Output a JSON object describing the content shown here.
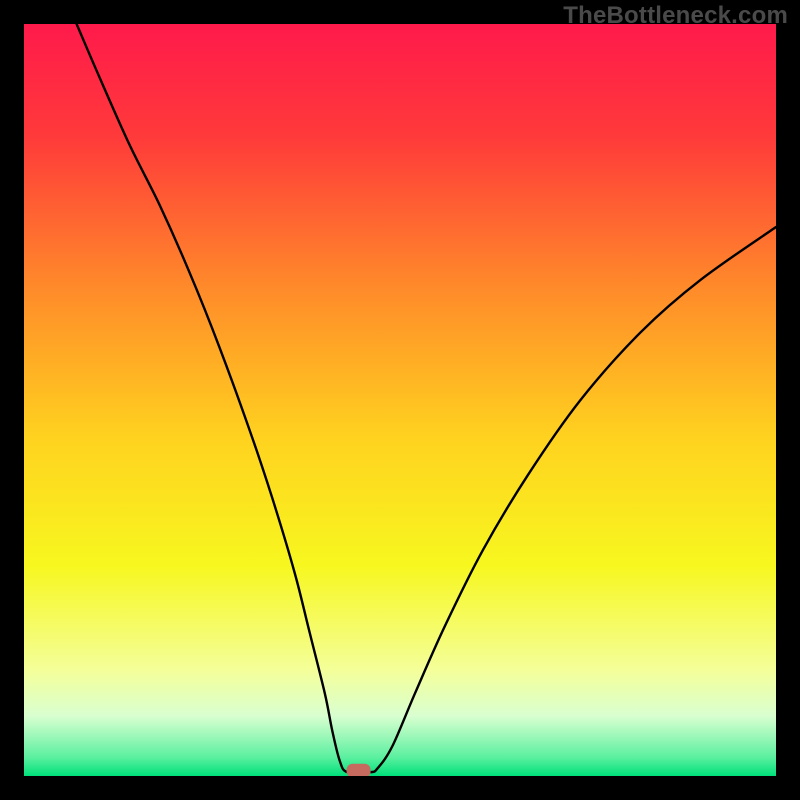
{
  "watermark": "TheBottleneck.com",
  "chart_data": {
    "type": "line",
    "title": "",
    "xlabel": "",
    "ylabel": "",
    "xlim": [
      0,
      100
    ],
    "ylim": [
      0,
      100
    ],
    "grid": false,
    "legend": false,
    "background_gradient": {
      "stops": [
        {
          "offset": 0.0,
          "color": "#ff1a4b"
        },
        {
          "offset": 0.15,
          "color": "#ff3a3a"
        },
        {
          "offset": 0.35,
          "color": "#ff8a2a"
        },
        {
          "offset": 0.55,
          "color": "#ffd21f"
        },
        {
          "offset": 0.72,
          "color": "#f7f71f"
        },
        {
          "offset": 0.86,
          "color": "#f4ff9a"
        },
        {
          "offset": 0.92,
          "color": "#d9ffd0"
        },
        {
          "offset": 0.975,
          "color": "#5cf0a0"
        },
        {
          "offset": 1.0,
          "color": "#00e07a"
        }
      ]
    },
    "series": [
      {
        "name": "bottleneck-curve",
        "color": "#000000",
        "points": [
          {
            "x": 7,
            "y": 100
          },
          {
            "x": 10,
            "y": 93
          },
          {
            "x": 14,
            "y": 84
          },
          {
            "x": 18,
            "y": 76
          },
          {
            "x": 22,
            "y": 67
          },
          {
            "x": 26,
            "y": 57
          },
          {
            "x": 30,
            "y": 46
          },
          {
            "x": 33,
            "y": 37
          },
          {
            "x": 36,
            "y": 27
          },
          {
            "x": 38,
            "y": 19
          },
          {
            "x": 40,
            "y": 11
          },
          {
            "x": 41,
            "y": 6
          },
          {
            "x": 42,
            "y": 2
          },
          {
            "x": 43,
            "y": 0.5
          },
          {
            "x": 46,
            "y": 0.5
          },
          {
            "x": 47,
            "y": 1
          },
          {
            "x": 49,
            "y": 4
          },
          {
            "x": 52,
            "y": 11
          },
          {
            "x": 56,
            "y": 20
          },
          {
            "x": 61,
            "y": 30
          },
          {
            "x": 67,
            "y": 40
          },
          {
            "x": 74,
            "y": 50
          },
          {
            "x": 82,
            "y": 59
          },
          {
            "x": 90,
            "y": 66
          },
          {
            "x": 100,
            "y": 73
          }
        ]
      }
    ],
    "marker": {
      "name": "optimal-marker",
      "x": 44.5,
      "y": 0.7,
      "color": "#c66a60"
    }
  }
}
